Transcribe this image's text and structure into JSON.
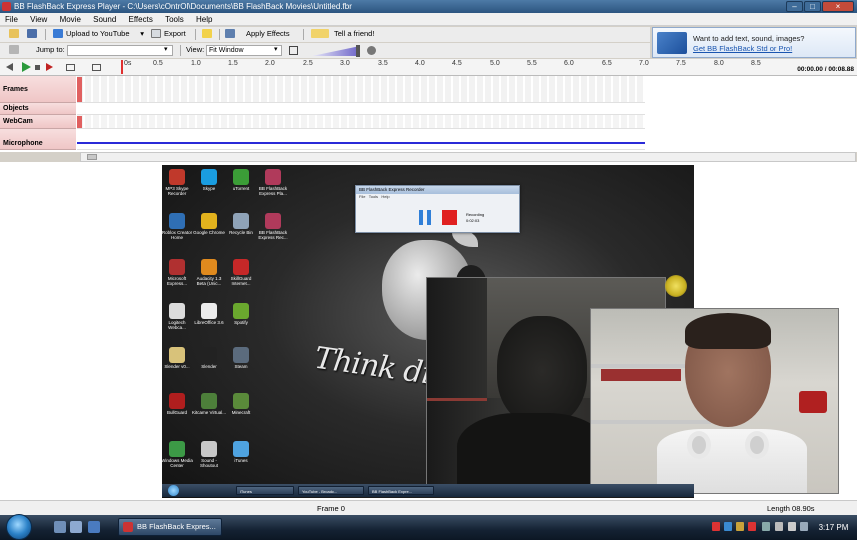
{
  "window": {
    "title": "BB FlashBack Express Player - C:\\Users\\cOntrOl\\Documents\\BB FlashBack Movies\\Untitled.fbr",
    "controls": [
      "–",
      "□",
      "×"
    ]
  },
  "menu": [
    "File",
    "View",
    "Movie",
    "Sound",
    "Effects",
    "Tools",
    "Help"
  ],
  "toolbar": {
    "upload_label": "Upload to YouTube",
    "export_label": "Export",
    "apply_effects_label": "Apply Effects",
    "tell_friend_label": "Tell a friend!",
    "jump_to_label": "Jump to:",
    "jump_to_value": "",
    "view_label": "View:",
    "view_value": "Fit Window"
  },
  "promo": {
    "line1": "Want to add text, sound, images?",
    "line2": "Get BB FlashBack Std or Pro!"
  },
  "ruler": {
    "ticks": [
      "0s",
      "0.5",
      "1.0",
      "1.5",
      "2.0",
      "2.5",
      "3.0",
      "3.5",
      "4.0",
      "4.5",
      "5.0",
      "5.5",
      "6.0",
      "6.5",
      "7.0",
      "7.5",
      "8.0",
      "8.5"
    ],
    "position_readout": "00:00.00 / 00:08.88"
  },
  "tracks": [
    "Frames",
    "Objects",
    "WebCam",
    "Microphone"
  ],
  "recording": {
    "desktop_icons": [
      {
        "label": "MP3 Skype Recorder",
        "color": "#c0392b"
      },
      {
        "label": "Skype",
        "color": "#1a9de0"
      },
      {
        "label": "uTorrent",
        "color": "#3b9d37"
      },
      {
        "label": "BB FlashBack Express Pla...",
        "color": "#b03a5b"
      },
      {
        "label": "Roblox Creator Home",
        "color": "#2f6fb5"
      },
      {
        "label": "Google Chrome",
        "color": "#e2b21d"
      },
      {
        "label": "Recycle Bin",
        "color": "#8fa3b8"
      },
      {
        "label": "BB FlashBack Express Rec...",
        "color": "#b03a5b"
      },
      {
        "label": "Microsoft Express...",
        "color": "#b03030"
      },
      {
        "label": "Audacity 1.3 Beta (Unic...",
        "color": "#e08a1e"
      },
      {
        "label": "SkillGuard Internet...",
        "color": "#c62828"
      },
      {
        "label": "Logitech Webca...",
        "color": "#dcdcdc"
      },
      {
        "label": "LibreOffice 3.6",
        "color": "#ececec"
      },
      {
        "label": "Spotify",
        "color": "#6aa82e"
      },
      {
        "label": "Slender v0...",
        "color": "#d8c27a"
      },
      {
        "label": "Slender",
        "color": "#222222"
      },
      {
        "label": "Steam",
        "color": "#5b6b7d"
      },
      {
        "label": "BullGuard",
        "color": "#b01e1e"
      },
      {
        "label": "Kitcame Virtual...",
        "color": "#4d7f3a"
      },
      {
        "label": "Minecraft",
        "color": "#5a8a3a"
      },
      {
        "label": "Windows Media Center",
        "color": "#3c9a46"
      },
      {
        "label": "Sound - Shoutout",
        "color": "#c8c8c8"
      },
      {
        "label": "iTunes",
        "color": "#4fa3e0"
      }
    ],
    "wallpaper_text": "Think diff",
    "recorder_window": {
      "title": "BB FlashBack Express Recorder",
      "menu": [
        "File",
        "Tools",
        "Help"
      ],
      "status": "Recording",
      "time": "0:02:03"
    },
    "taskbar_items": [
      "iTunes",
      "YouTube - Broadc...",
      "BB FlashBack Expre..."
    ]
  },
  "statusbar": {
    "frame": "Frame 0",
    "length": "Length 08.90s"
  },
  "taskbar": {
    "active_item": "BB FlashBack Expres...",
    "clock": "3:17 PM"
  }
}
